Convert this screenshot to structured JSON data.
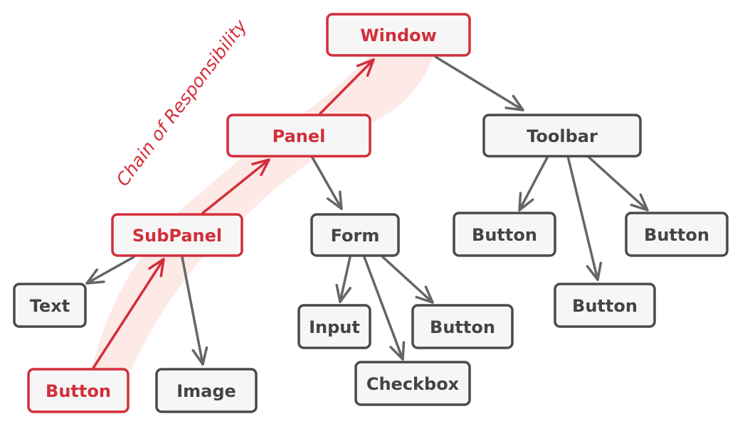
{
  "title": "Chain of Responsibility",
  "colors": {
    "accent": "#d22f3a",
    "node_border": "#4a4a4a",
    "node_fill": "#f6f6f6",
    "edge": "#666666",
    "highlight_band": "#fde9e6"
  },
  "nodes": [
    {
      "id": "window",
      "label": "Window",
      "in_chain": true
    },
    {
      "id": "panel",
      "label": "Panel",
      "in_chain": true
    },
    {
      "id": "toolbar",
      "label": "Toolbar",
      "in_chain": false
    },
    {
      "id": "subpanel",
      "label": "SubPanel",
      "in_chain": true
    },
    {
      "id": "form",
      "label": "Form",
      "in_chain": false
    },
    {
      "id": "tb-button-1",
      "label": "Button",
      "in_chain": false
    },
    {
      "id": "tb-button-3",
      "label": "Button",
      "in_chain": false
    },
    {
      "id": "text",
      "label": "Text",
      "in_chain": false
    },
    {
      "id": "input",
      "label": "Input",
      "in_chain": false
    },
    {
      "id": "form-button",
      "label": "Button",
      "in_chain": false
    },
    {
      "id": "tb-button-2",
      "label": "Button",
      "in_chain": false
    },
    {
      "id": "button",
      "label": "Button",
      "in_chain": true
    },
    {
      "id": "image",
      "label": "Image",
      "in_chain": false
    },
    {
      "id": "checkbox",
      "label": "Checkbox",
      "in_chain": false
    }
  ],
  "edges": [
    {
      "from": "window",
      "to": "toolbar",
      "chain": false
    },
    {
      "from": "panel",
      "to": "form",
      "chain": false
    },
    {
      "from": "toolbar",
      "to": "tb-button-1",
      "chain": false
    },
    {
      "from": "toolbar",
      "to": "tb-button-2",
      "chain": false
    },
    {
      "from": "toolbar",
      "to": "tb-button-3",
      "chain": false
    },
    {
      "from": "subpanel",
      "to": "text",
      "chain": false
    },
    {
      "from": "subpanel",
      "to": "image",
      "chain": false
    },
    {
      "from": "form",
      "to": "input",
      "chain": false
    },
    {
      "from": "form",
      "to": "checkbox",
      "chain": false
    },
    {
      "from": "form",
      "to": "form-button",
      "chain": false
    },
    {
      "from": "button",
      "to": "subpanel",
      "chain": true
    },
    {
      "from": "subpanel",
      "to": "panel",
      "chain": true
    },
    {
      "from": "panel",
      "to": "window",
      "chain": true
    }
  ]
}
